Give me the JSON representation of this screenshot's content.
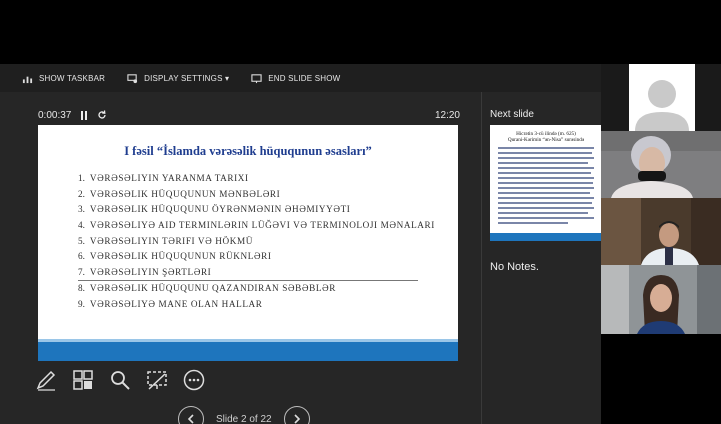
{
  "toolbar": {
    "show_taskbar": "SHOW TASKBAR",
    "display_settings": "DISPLAY SETTINGS ▾",
    "end_slide_show": "END SLIDE SHOW"
  },
  "timer": {
    "elapsed": "0:00:37",
    "clock": "12:20"
  },
  "current_slide": {
    "title": "I fəsil “İslamda vərəsəlik hüququnun əsasları”",
    "items": [
      {
        "num": "1.",
        "text": "Vərəsəliyin yaranma tarixi"
      },
      {
        "num": "2.",
        "text": "Vərəsəlik hüququnun mənbələri"
      },
      {
        "num": "3.",
        "text": "Vərəsəlik hüququnu öyrənmənin əhəmiyyəti"
      },
      {
        "num": "4.",
        "text": "Vərəsəliyə aid terminlərin lüğəvi və terminoloji mənaları"
      },
      {
        "num": "5.",
        "text": "Vərəsəliyin tərifi və hökmü"
      },
      {
        "num": "6.",
        "text": "Vərəsəlik hüququnun rüknləri"
      },
      {
        "num": "7.",
        "text": "Vərəsəliyin şərtləri"
      },
      {
        "num": "8.",
        "text": "Vərəsəlik hüququnu qazandıran səbəblər"
      },
      {
        "num": "9.",
        "text": "Vərəsəliyə mane olan hallar"
      }
    ]
  },
  "navigation": {
    "slide_counter": "Slide 2 of 22"
  },
  "next_slide": {
    "label": "Next slide",
    "title_line1": "Hicrətin 3-cü ilində (m. 625)",
    "title_line2": "Qurani-Kərimin “ən-Nisa” surəsində"
  },
  "notes": "No Notes.",
  "colors": {
    "slide_title": "#1f3d8f",
    "slide_band": "#1e75bd",
    "toolbar_bg": "#1f1f1f",
    "pane_bg": "#262626"
  }
}
